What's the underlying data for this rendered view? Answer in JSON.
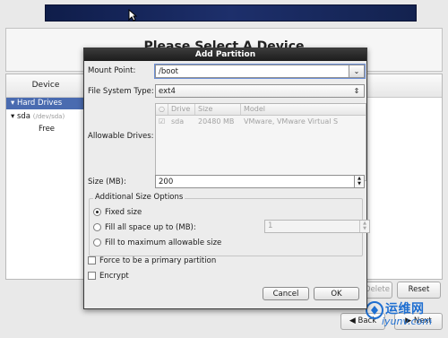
{
  "background": {
    "page_heading": "Please Select A Device",
    "device_header": "Device",
    "tree": {
      "hard_drives": "Hard Drives",
      "sda_label": "sda",
      "sda_path": "(/dev/sda)",
      "free": "Free"
    },
    "buttons": {
      "delete": "Delete",
      "reset": "Reset",
      "back": "Back",
      "next": "Next"
    },
    "watermark": {
      "text": "运维网",
      "url": "iyunv.com"
    }
  },
  "dialog": {
    "title": "Add Partition",
    "mount_point_label": "Mount Point:",
    "mount_point_value": "/boot",
    "fs_type_label": "File System Type:",
    "fs_type_value": "ext4",
    "allowable_drives_label": "Allowable Drives:",
    "drives_table": {
      "columns": [
        "Drive",
        "Size",
        "Model"
      ],
      "rows": [
        {
          "checked": true,
          "drive": "sda",
          "size": "20480 MB",
          "model": "VMware, VMware Virtual S"
        }
      ]
    },
    "size_label": "Size (MB):",
    "size_value": "200",
    "size_options_title": "Additional Size Options",
    "options": {
      "fixed": "Fixed size",
      "fill_up_to": "Fill all space up to (MB):",
      "fill_max": "Fill to maximum allowable size",
      "selected": "fixed",
      "fill_up_to_value": "1"
    },
    "primary_partition_label": "Force to be a primary partition",
    "encrypt_label": "Encrypt",
    "cancel_label": "Cancel",
    "ok_label": "OK"
  },
  "colors": {
    "title_bar": "#1c1c1c",
    "selection": "#4a6bb0",
    "banner": "#1d2f6b"
  }
}
